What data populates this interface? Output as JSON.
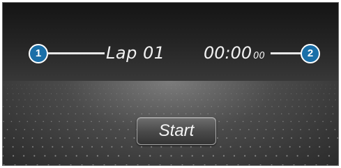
{
  "lap": {
    "label": "Lap 01"
  },
  "timer": {
    "main": "00:00",
    "hundredths": "00"
  },
  "callouts": [
    {
      "label": "1"
    },
    {
      "label": "2"
    }
  ],
  "controls": {
    "start_label": "Start"
  },
  "colors": {
    "callout_fill": "#1a6fa8",
    "text": "#f2f2f2"
  }
}
